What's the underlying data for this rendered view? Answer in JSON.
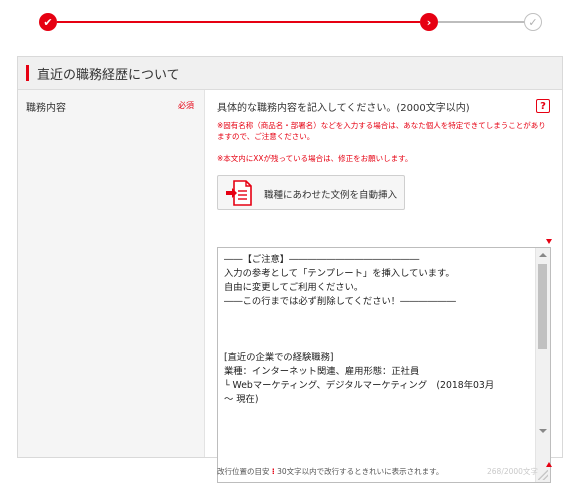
{
  "progress": {
    "steps": [
      {
        "state": "done",
        "glyph": "✔"
      },
      {
        "state": "current",
        "glyph": "›"
      },
      {
        "state": "todo",
        "glyph": "✓"
      }
    ],
    "colors": {
      "active": "#e60012",
      "inactive": "#bdbdbd"
    }
  },
  "section": {
    "title": "直近の職務経歴について"
  },
  "field": {
    "label": "職務内容",
    "required": "必須",
    "instruction": "具体的な職務内容を記入してください。(2000文字以内)",
    "help": "?",
    "note1": "※固有名称（商品名・部署名）などを入力する場合は、あなた個人を特定できてしまうことがありますので、ご注意ください。",
    "note2": "※本文内にXXが残っている場合は、修正をお願いします。",
    "insert_button": "職種にあわせた文例を自動挿入",
    "textarea_value": "――【ご注意】――――――――――――――\n入力の参考として「テンプレート」を挿入しています。\n自由に変更してご利用ください。\n――この行までは必ず削除してください！――――――\n\n\n\n[直近の企業での経験職務]\n業種：インターネット関連、雇用形態：正社員\n└ Webマーケティング、デジタルマーケティング　(2018年03月\n～ 現在)",
    "footer_prefix": "改行位置の目安",
    "footer_suffix": "30文字以内で改行するときれいに表示されます。",
    "counter": "268/2000文字"
  },
  "icons": [
    "check-icon",
    "chevron-right-icon",
    "check-outline-icon",
    "document-insert-icon",
    "help-icon"
  ]
}
